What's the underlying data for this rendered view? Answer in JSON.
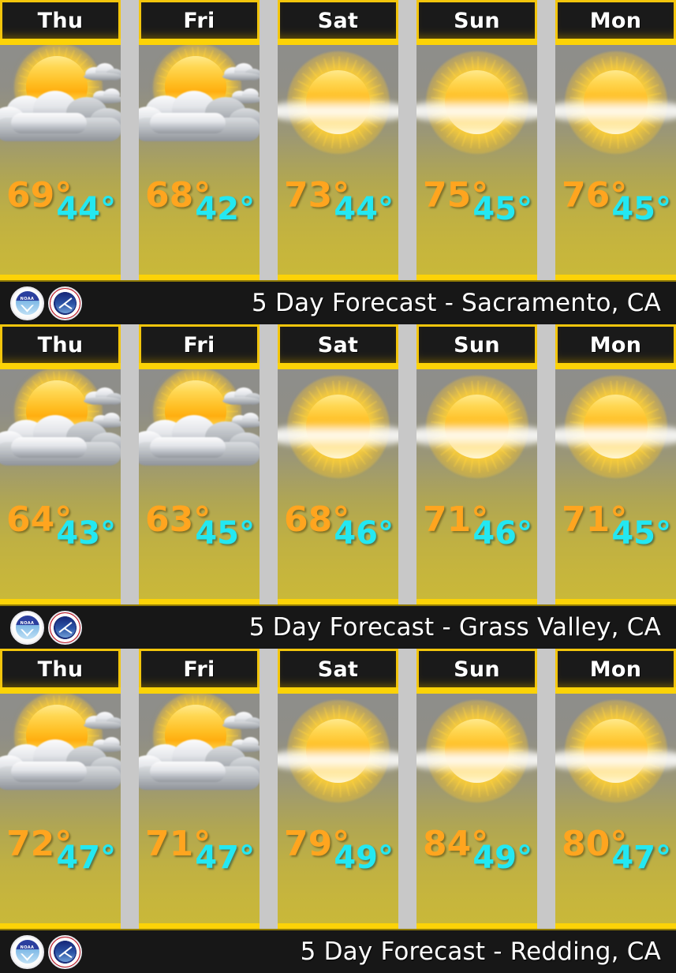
{
  "panels": [
    {
      "title": "5 Day Forecast - Sacramento, CA",
      "logos": {
        "noaa": "noaa-logo",
        "nws": "national-weather-service-logo"
      },
      "days": [
        {
          "day": "Thu",
          "icon": "partly-cloudy-icon",
          "high": "69°",
          "low": "44°"
        },
        {
          "day": "Fri",
          "icon": "partly-cloudy-icon",
          "high": "68°",
          "low": "42°"
        },
        {
          "day": "Sat",
          "icon": "sunny-hazy-icon",
          "high": "73°",
          "low": "44°"
        },
        {
          "day": "Sun",
          "icon": "sunny-hazy-icon",
          "high": "75°",
          "low": "45°"
        },
        {
          "day": "Mon",
          "icon": "sunny-hazy-icon",
          "high": "76°",
          "low": "45°"
        }
      ]
    },
    {
      "title": "5 Day Forecast - Grass Valley, CA",
      "logos": {
        "noaa": "noaa-logo",
        "nws": "national-weather-service-logo"
      },
      "days": [
        {
          "day": "Thu",
          "icon": "partly-cloudy-icon",
          "high": "64°",
          "low": "43°"
        },
        {
          "day": "Fri",
          "icon": "partly-cloudy-icon",
          "high": "63°",
          "low": "45°"
        },
        {
          "day": "Sat",
          "icon": "sunny-hazy-icon",
          "high": "68°",
          "low": "46°"
        },
        {
          "day": "Sun",
          "icon": "sunny-hazy-icon",
          "high": "71°",
          "low": "46°"
        },
        {
          "day": "Mon",
          "icon": "sunny-hazy-icon",
          "high": "71°",
          "low": "45°"
        }
      ]
    },
    {
      "title": "5 Day Forecast - Redding, CA",
      "logos": {
        "noaa": "noaa-logo",
        "nws": "national-weather-service-logo"
      },
      "days": [
        {
          "day": "Thu",
          "icon": "partly-cloudy-icon",
          "high": "72°",
          "low": "47°"
        },
        {
          "day": "Fri",
          "icon": "partly-cloudy-icon",
          "high": "71°",
          "low": "47°"
        },
        {
          "day": "Sat",
          "icon": "sunny-hazy-icon",
          "high": "79°",
          "low": "49°"
        },
        {
          "day": "Sun",
          "icon": "sunny-hazy-icon",
          "high": "84°",
          "low": "49°"
        },
        {
          "day": "Mon",
          "icon": "sunny-hazy-icon",
          "high": "80°",
          "low": "47°"
        }
      ]
    }
  ],
  "colors": {
    "accent_border": "#fcd307",
    "header_bg": "#1a1a1a",
    "footer_bg": "#171717",
    "high_temp": "#ffa51f",
    "low_temp": "#23e8f2",
    "gutter": "#c8c8c8"
  },
  "noaa_logo_text": "NOAA"
}
